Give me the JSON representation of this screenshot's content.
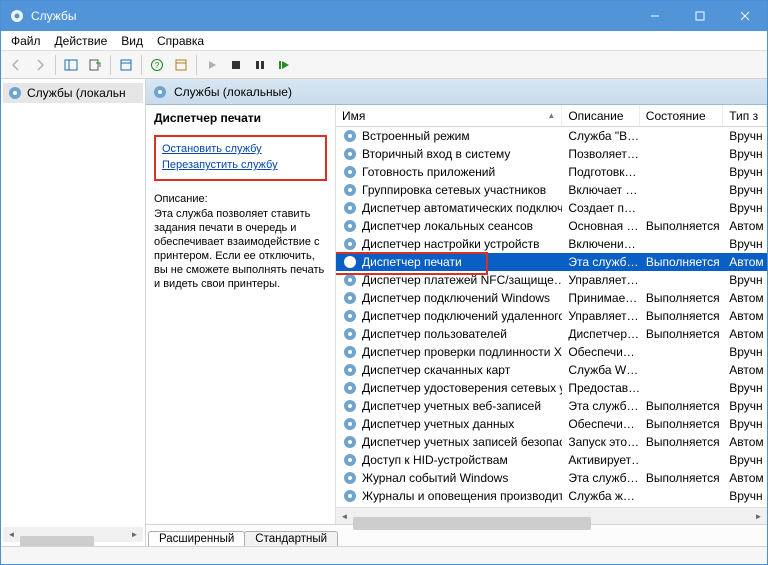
{
  "title": "Службы",
  "menu": {
    "file": "Файл",
    "action": "Действие",
    "view": "Вид",
    "help": "Справка"
  },
  "tree": {
    "root": "Службы (локальн"
  },
  "content_header": "Службы (локальные)",
  "detail": {
    "service_name": "Диспетчер печати",
    "stop_link": "Остановить службу",
    "restart_link": "Перезапустить службу",
    "desc_label": "Описание:",
    "desc_text": "Эта служба позволяет ставить задания печати в очередь и обеспечивает взаимодействие с принтером. Если ее отключить, вы не сможете выполнять печать и видеть свои принтеры."
  },
  "columns": {
    "name": "Имя",
    "desc": "Описание",
    "state": "Состояние",
    "type": "Тип з"
  },
  "tabs": {
    "extended": "Расширенный",
    "standard": "Стандартный"
  },
  "services": [
    {
      "name": "Встроенный режим",
      "desc": "Служба \"В…",
      "state": "",
      "type": "Вручн"
    },
    {
      "name": "Вторичный вход в систему",
      "desc": "Позволяет…",
      "state": "",
      "type": "Вручн"
    },
    {
      "name": "Готовность приложений",
      "desc": "Подготовк…",
      "state": "",
      "type": "Вручн"
    },
    {
      "name": "Группировка сетевых участников",
      "desc": "Включает …",
      "state": "",
      "type": "Вручн"
    },
    {
      "name": "Диспетчер автоматических подключ…",
      "desc": "Создает п…",
      "state": "",
      "type": "Вручн"
    },
    {
      "name": "Диспетчер локальных сеансов",
      "desc": "Основная …",
      "state": "Выполняется",
      "type": "Автом"
    },
    {
      "name": "Диспетчер настройки устройств",
      "desc": "Включени…",
      "state": "",
      "type": "Вручн"
    },
    {
      "name": "Диспетчер печати",
      "desc": "Эта служб…",
      "state": "Выполняется",
      "type": "Автом",
      "selected": true
    },
    {
      "name": "Диспетчер платежей NFC/защище…",
      "desc": "Управляет…",
      "state": "",
      "type": "Вручн"
    },
    {
      "name": "Диспетчер подключений Windows",
      "desc": "Принимае…",
      "state": "Выполняется",
      "type": "Автом"
    },
    {
      "name": "Диспетчер подключений удаленного…",
      "desc": "Управляет…",
      "state": "Выполняется",
      "type": "Автом"
    },
    {
      "name": "Диспетчер пользователей",
      "desc": "Диспетчер…",
      "state": "Выполняется",
      "type": "Автом"
    },
    {
      "name": "Диспетчер проверки подлинности X…",
      "desc": "Обеспечи…",
      "state": "",
      "type": "Вручн"
    },
    {
      "name": "Диспетчер скачанных карт",
      "desc": "Служба W…",
      "state": "",
      "type": "Автом"
    },
    {
      "name": "Диспетчер удостоверения сетевых уч…",
      "desc": "Предостав…",
      "state": "",
      "type": "Вручн"
    },
    {
      "name": "Диспетчер учетных веб-записей",
      "desc": "Эта служб…",
      "state": "Выполняется",
      "type": "Вручн"
    },
    {
      "name": "Диспетчер учетных данных",
      "desc": "Обеспечи…",
      "state": "Выполняется",
      "type": "Вручн"
    },
    {
      "name": "Диспетчер учетных записей безопасн…",
      "desc": "Запуск это…",
      "state": "Выполняется",
      "type": "Автом"
    },
    {
      "name": "Доступ к HID-устройствам",
      "desc": "Активирует…",
      "state": "",
      "type": "Вручн"
    },
    {
      "name": "Журнал событий Windows",
      "desc": "Эта служб…",
      "state": "Выполняется",
      "type": "Автом"
    },
    {
      "name": "Журналы и оповещения производите…",
      "desc": "Служба ж…",
      "state": "",
      "type": "Вручн"
    }
  ]
}
